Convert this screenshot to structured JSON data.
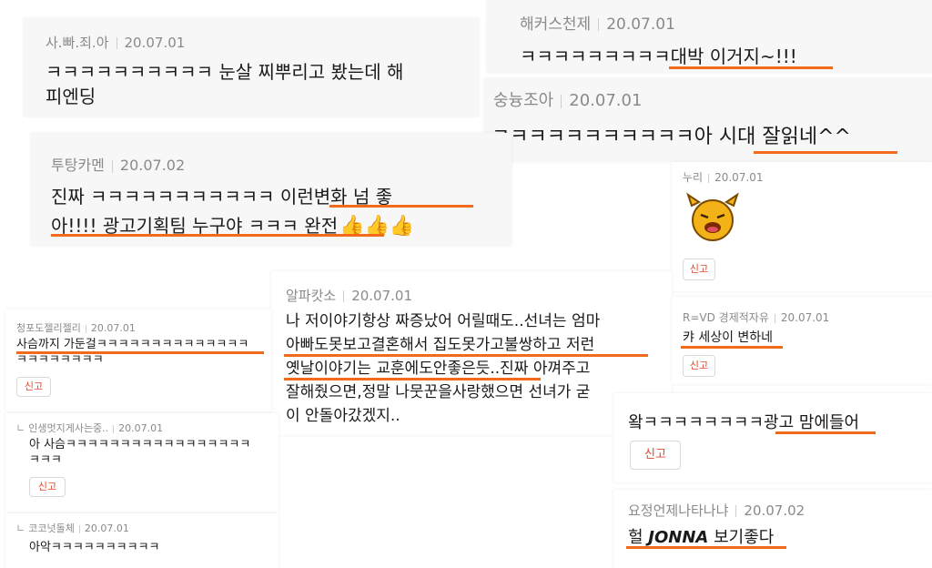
{
  "accent_color": "#f26a1b",
  "report_label": "신고",
  "comments": [
    {
      "user": "사.빠.죄.아",
      "date": "20.07.01",
      "lines": [
        "ㅋㅋㅋㅋㅋㅋㅋㅋㅋㅋ 눈살 찌뿌리고 봤는데 해",
        "피엔딩"
      ]
    },
    {
      "user": "해커스천제",
      "date": "20.07.01",
      "lines": [
        "ㅋㅋㅋㅋㅋㅋㅋㅋㅋ대박 이거지~!!!"
      ]
    },
    {
      "user": "숭늉조아",
      "date": "20.07.01",
      "lines": [
        "ㅋㅋㅋㅋㅋㅋㅋㅋㅋㅋㅋ아 시대 잘읽네^^"
      ]
    },
    {
      "user": "투탕카멘",
      "date": "20.07.02",
      "lines": [
        "진짜 ㅋㅋㅋㅋㅋㅋㅋㅋㅋㅋㅋ 이런변화 넘 좋",
        "아!!!! 광고기획팀 누구야 ㅋㅋㅋ 완전"
      ],
      "emoji": "👍👍👍"
    },
    {
      "user": "누리",
      "date": "20.07.01",
      "sticker": "sticker-character"
    },
    {
      "user": "알파캇소",
      "date": "20.07.01",
      "lines": [
        "나 저이야기항상 짜증났어 어릴때도..선녀는 엄마",
        "아빠도못보고결혼해서 집도못가고불쌍하고 저런",
        "옛날이야기는 교훈에도안좋은듯..진짜 아껴주고",
        "잘해줬으면,정말 나뭇꾼을사랑했으면 선녀가 굳",
        "이 안돌아갔겠지.."
      ]
    },
    {
      "user": "청포도젤리젤리",
      "date": "20.07.01",
      "lines": [
        "사슴까지 가둔걸ㅋㅋㅋㅋㅋㅋㅋㅋㅋㅋㅋㅋㅋㅋ",
        "ㅋㅋㅋㅋㅋㅋㅋㅋ"
      ]
    },
    {
      "user": "인생멋지게사는중..",
      "date": "20.07.01",
      "lines": [
        "아 사슴ㅋㅋㅋㅋㅋㅋㅋㅋㅋㅋㅋㅋㅋㅋㅋㅋㅋ",
        "ㅋㅋㅋ"
      ]
    },
    {
      "user": "코코넛돌체",
      "date": "20.07.01",
      "lines": [
        "아악ㅋㅋㅋㅋㅋㅋㅋㅋㅋㅋ"
      ]
    },
    {
      "user": "R=VD 경제적자유",
      "date": "20.07.01",
      "lines": [
        "캬 세상이 변하네"
      ]
    },
    {
      "user": "",
      "date": "",
      "lines": [
        "왘ㅋㅋㅋㅋㅋㅋㅋㅋ광고 맘에들어"
      ]
    },
    {
      "user": "요정언제나타나냐",
      "date": "20.07.02",
      "lines": [
        "헐 JONNA 보기좋다"
      ],
      "bold_word": "JONNA"
    }
  ]
}
